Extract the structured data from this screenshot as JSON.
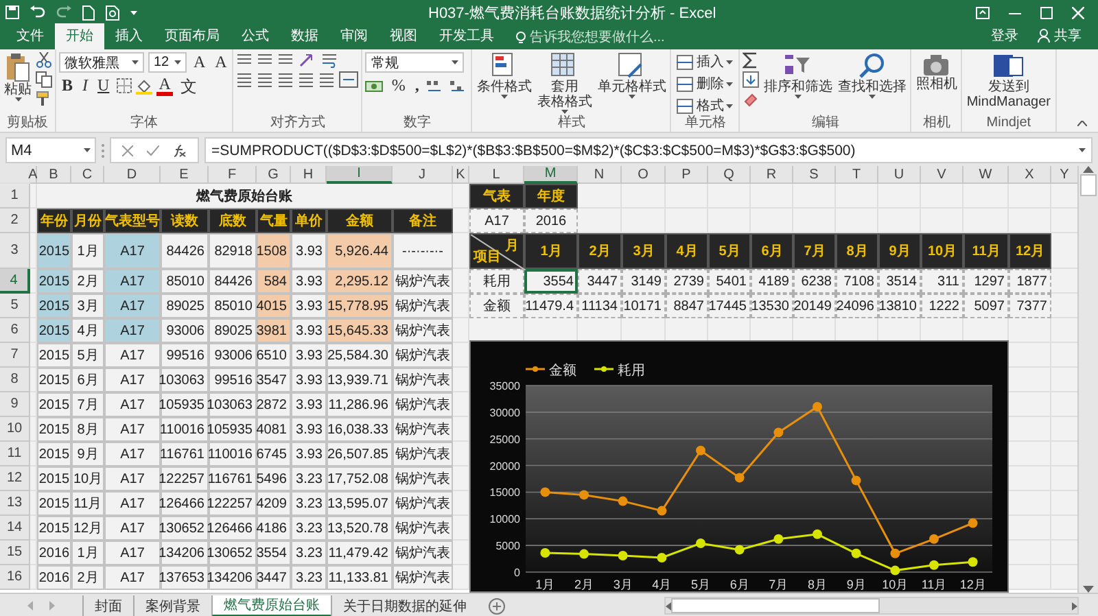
{
  "window": {
    "title": "H037-燃气费消耗台账数据统计分析 - Excel"
  },
  "ribbon_tabs": [
    {
      "label": "文件",
      "selected": false
    },
    {
      "label": "开始",
      "selected": true
    },
    {
      "label": "插入",
      "selected": false
    },
    {
      "label": "页面布局",
      "selected": false
    },
    {
      "label": "公式",
      "selected": false
    },
    {
      "label": "数据",
      "selected": false
    },
    {
      "label": "审阅",
      "selected": false
    },
    {
      "label": "视图",
      "selected": false
    },
    {
      "label": "开发工具",
      "selected": false
    }
  ],
  "tell_me": {
    "placeholder": "告诉我您想要做什么..."
  },
  "account": {
    "sign_in": "登录",
    "share": "共享"
  },
  "ribbon_groups": [
    {
      "kind": "clipboard",
      "name": "剪贴板",
      "paste": "粘贴"
    },
    {
      "kind": "font",
      "name": "字体",
      "font": "微软雅黑",
      "size": "12",
      "grow": "A",
      "shrink": "A",
      "styles": [
        "B",
        "I",
        "U"
      ],
      "color_letter": "A",
      "phonetic": "文"
    },
    {
      "kind": "align",
      "name": "对齐方式"
    },
    {
      "kind": "number",
      "name": "数字",
      "format": "常规",
      "percent": "%",
      "comma": ","
    },
    {
      "kind": "styles",
      "name": "样式",
      "buttons": [
        {
          "lines": [
            "条件格式"
          ]
        },
        {
          "lines": [
            "套用",
            "表格格式"
          ]
        },
        {
          "lines": [
            "单元格样式"
          ]
        }
      ]
    },
    {
      "kind": "cells",
      "name": "单元格",
      "buttons": [
        "插入",
        "删除",
        "格式"
      ]
    },
    {
      "kind": "editing",
      "name": "编辑",
      "buttons": [
        "排序和筛选",
        "查找和选择"
      ]
    },
    {
      "kind": "camera",
      "name": "相机",
      "button": "照相机"
    },
    {
      "kind": "mindjet",
      "name": "Mindjet",
      "lines": [
        "发送到",
        "MindManager"
      ]
    }
  ],
  "formula_bar": {
    "name_box": "M4",
    "formula": "=SUMPRODUCT(($D$3:$D$500=$L$2)*($B$3:$B$500=$M$2)*($C$3:$C$500=M$3)*$G$3:$G$500)"
  },
  "columns": [
    {
      "label": "A",
      "highlighted": false
    },
    {
      "label": "B",
      "highlighted": false
    },
    {
      "label": "C",
      "highlighted": false
    },
    {
      "label": "D",
      "highlighted": false
    },
    {
      "label": "E",
      "highlighted": false
    },
    {
      "label": "F",
      "highlighted": false
    },
    {
      "label": "G",
      "highlighted": false
    },
    {
      "label": "H",
      "highlighted": false
    },
    {
      "label": "I",
      "highlighted": true
    },
    {
      "label": "J",
      "highlighted": false
    },
    {
      "label": "K",
      "highlighted": false
    },
    {
      "label": "L",
      "highlighted": false
    },
    {
      "label": "M",
      "highlighted": true
    },
    {
      "label": "N",
      "highlighted": false
    },
    {
      "label": "O",
      "highlighted": false
    },
    {
      "label": "P",
      "highlighted": false
    },
    {
      "label": "Q",
      "highlighted": false
    },
    {
      "label": "R",
      "highlighted": false
    },
    {
      "label": "S",
      "highlighted": false
    },
    {
      "label": "T",
      "highlighted": false
    },
    {
      "label": "U",
      "highlighted": false
    },
    {
      "label": "V",
      "highlighted": false
    },
    {
      "label": "W",
      "highlighted": false
    },
    {
      "label": "X",
      "highlighted": false
    },
    {
      "label": "Y",
      "highlighted": false
    }
  ],
  "rows": [
    {
      "label": "1",
      "highlighted": false
    },
    {
      "label": "2",
      "highlighted": false
    },
    {
      "label": "3",
      "highlighted": false
    },
    {
      "label": "4",
      "highlighted": true
    },
    {
      "label": "5",
      "highlighted": false
    },
    {
      "label": "6",
      "highlighted": false
    },
    {
      "label": "7",
      "highlighted": false
    },
    {
      "label": "8",
      "highlighted": false
    },
    {
      "label": "9",
      "highlighted": false
    },
    {
      "label": "10",
      "highlighted": false
    },
    {
      "label": "11",
      "highlighted": false
    },
    {
      "label": "12",
      "highlighted": false
    },
    {
      "label": "13",
      "highlighted": false
    },
    {
      "label": "14",
      "highlighted": false
    },
    {
      "label": "15",
      "highlighted": false
    },
    {
      "label": "16",
      "highlighted": false
    }
  ],
  "ledger": {
    "title": "燃气费原始台账",
    "headers": [
      "年份",
      "月份",
      "气表型号",
      "读数",
      "底数",
      "气量",
      "单价",
      "金额",
      "备注"
    ],
    "rows": [
      {
        "highlighted": true,
        "cells": [
          "2015",
          "1月",
          "A17",
          "84426",
          "82918",
          "1508",
          "3.93",
          "5,926.44",
          "-·-·-·-·-"
        ]
      },
      {
        "highlighted": true,
        "cells": [
          "2015",
          "2月",
          "A17",
          "85010",
          "84426",
          "584",
          "3.93",
          "2,295.12",
          "锅炉汽表"
        ]
      },
      {
        "highlighted": true,
        "cells": [
          "2015",
          "3月",
          "A17",
          "89025",
          "85010",
          "4015",
          "3.93",
          "15,778.95",
          "锅炉汽表"
        ]
      },
      {
        "highlighted": true,
        "cells": [
          "2015",
          "4月",
          "A17",
          "93006",
          "89025",
          "3981",
          "3.93",
          "15,645.33",
          "锅炉汽表"
        ]
      },
      {
        "highlighted": false,
        "cells": [
          "2015",
          "5月",
          "A17",
          "99516",
          "93006",
          "6510",
          "3.93",
          "25,584.30",
          "锅炉汽表"
        ]
      },
      {
        "highlighted": false,
        "cells": [
          "2015",
          "6月",
          "A17",
          "103063",
          "99516",
          "3547",
          "3.93",
          "13,939.71",
          "锅炉汽表"
        ]
      },
      {
        "highlighted": false,
        "cells": [
          "2015",
          "7月",
          "A17",
          "105935",
          "103063",
          "2872",
          "3.93",
          "11,286.96",
          "锅炉汽表"
        ]
      },
      {
        "highlighted": false,
        "cells": [
          "2015",
          "8月",
          "A17",
          "110016",
          "105935",
          "4081",
          "3.93",
          "16,038.33",
          "锅炉汽表"
        ]
      },
      {
        "highlighted": false,
        "cells": [
          "2015",
          "9月",
          "A17",
          "116761",
          "110016",
          "6745",
          "3.93",
          "26,507.85",
          "锅炉汽表"
        ]
      },
      {
        "highlighted": false,
        "cells": [
          "2015",
          "10月",
          "A17",
          "122257",
          "116761",
          "5496",
          "3.23",
          "17,752.08",
          "锅炉汽表"
        ]
      },
      {
        "highlighted": false,
        "cells": [
          "2015",
          "11月",
          "A17",
          "126466",
          "122257",
          "4209",
          "3.23",
          "13,595.07",
          "锅炉汽表"
        ]
      },
      {
        "highlighted": false,
        "cells": [
          "2015",
          "12月",
          "A17",
          "130652",
          "126466",
          "4186",
          "3.23",
          "13,520.78",
          "锅炉汽表"
        ]
      },
      {
        "highlighted": false,
        "cells": [
          "2016",
          "1月",
          "A17",
          "134206",
          "130652",
          "3554",
          "3.23",
          "11,479.42",
          "锅炉汽表"
        ]
      },
      {
        "highlighted": false,
        "cells": [
          "2016",
          "2月",
          "A17",
          "137653",
          "134206",
          "3447",
          "3.23",
          "11,133.81",
          "锅炉汽表"
        ]
      }
    ]
  },
  "lookup": {
    "headers": [
      "气表",
      "年度"
    ],
    "values": [
      "A17",
      "2016"
    ]
  },
  "summary": {
    "corner_top": "月",
    "corner_bottom": "项目",
    "months": [
      "1月",
      "2月",
      "3月",
      "4月",
      "5月",
      "6月",
      "7月",
      "8月",
      "9月",
      "10月",
      "11月",
      "12月"
    ],
    "rows": [
      {
        "label": "耗用",
        "values": [
          {
            "text": "3554",
            "selected": true
          },
          {
            "text": "3447",
            "selected": false
          },
          {
            "text": "3149",
            "selected": false
          },
          {
            "text": "2739",
            "selected": false
          },
          {
            "text": "5401",
            "selected": false
          },
          {
            "text": "4189",
            "selected": false
          },
          {
            "text": "6238",
            "selected": false
          },
          {
            "text": "7108",
            "selected": false
          },
          {
            "text": "3514",
            "selected": false
          },
          {
            "text": "311",
            "selected": false
          },
          {
            "text": "1297",
            "selected": false
          },
          {
            "text": "1877",
            "selected": false
          }
        ]
      },
      {
        "label": "金额",
        "values": [
          {
            "text": "11479.4",
            "selected": false
          },
          {
            "text": "11134",
            "selected": false
          },
          {
            "text": "10171",
            "selected": false
          },
          {
            "text": "8847",
            "selected": false
          },
          {
            "text": "17445",
            "selected": false
          },
          {
            "text": "13530",
            "selected": false
          },
          {
            "text": "20149",
            "selected": false
          },
          {
            "text": "24096",
            "selected": false
          },
          {
            "text": "13810",
            "selected": false
          },
          {
            "text": "1222",
            "selected": false
          },
          {
            "text": "5097",
            "selected": false
          },
          {
            "text": "7377",
            "selected": false
          }
        ]
      }
    ]
  },
  "chart": {
    "chart_data": {
      "type": "line",
      "categories": [
        "1月",
        "2月",
        "3月",
        "4月",
        "5月",
        "6月",
        "7月",
        "8月",
        "9月",
        "10月",
        "11月",
        "12月"
      ],
      "series": [
        {
          "name": "金额",
          "color": "#e8900c",
          "marker": "circle",
          "values": [
            15000,
            14500,
            13300,
            11500,
            22800,
            17700,
            26200,
            31000,
            17200,
            3500,
            6200,
            9200
          ]
        },
        {
          "name": "耗用",
          "color": "#d6e400",
          "marker": "circle",
          "values": [
            3600,
            3400,
            3100,
            2700,
            5400,
            4200,
            6200,
            7100,
            3500,
            300,
            1300,
            1900
          ]
        }
      ],
      "ylim": [
        0,
        35000
      ],
      "yticks": [
        0,
        5000,
        10000,
        15000,
        20000,
        25000,
        30000,
        35000
      ],
      "grid": true,
      "legend": "top-left"
    }
  },
  "sheet_tabs": [
    {
      "label": "封面",
      "selected": false
    },
    {
      "label": "案例背景",
      "selected": false
    },
    {
      "label": "燃气费原始台账",
      "selected": true
    },
    {
      "label": "关于日期数据的延伸",
      "selected": false
    }
  ]
}
